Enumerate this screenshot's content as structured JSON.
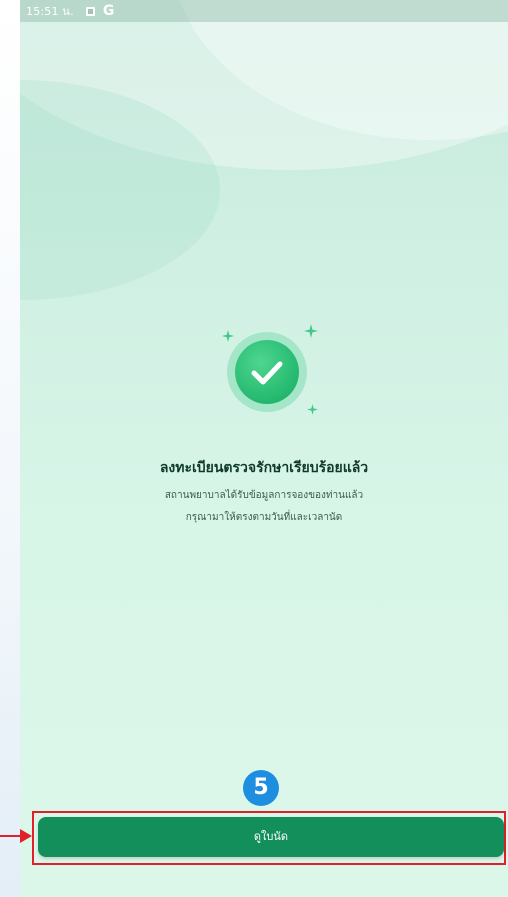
{
  "status_bar": {
    "time": "15:51 น.",
    "icons": [
      "notification-square-icon",
      "google-g-icon"
    ],
    "g_label": "G"
  },
  "content": {
    "success_icon": "check-circle-icon",
    "title": "ลงทะเบียนตรวจรักษาเรียบร้อยแล้ว",
    "subtitle_line1": "สถานพยาบาลได้รับข้อมูลการจองของท่านแล้ว",
    "subtitle_line2": "กรุณามาให้ตรงตามวันที่และเวลานัด"
  },
  "action_button": {
    "label": "ดูใบนัด"
  },
  "annotation": {
    "step_number": "5",
    "badge_color": "#1e8fe0",
    "highlight_color": "#e0202a"
  },
  "colors": {
    "primary_green": "#138f5b",
    "success_green": "#24b86f",
    "background_mint": "#d8f6e8"
  }
}
